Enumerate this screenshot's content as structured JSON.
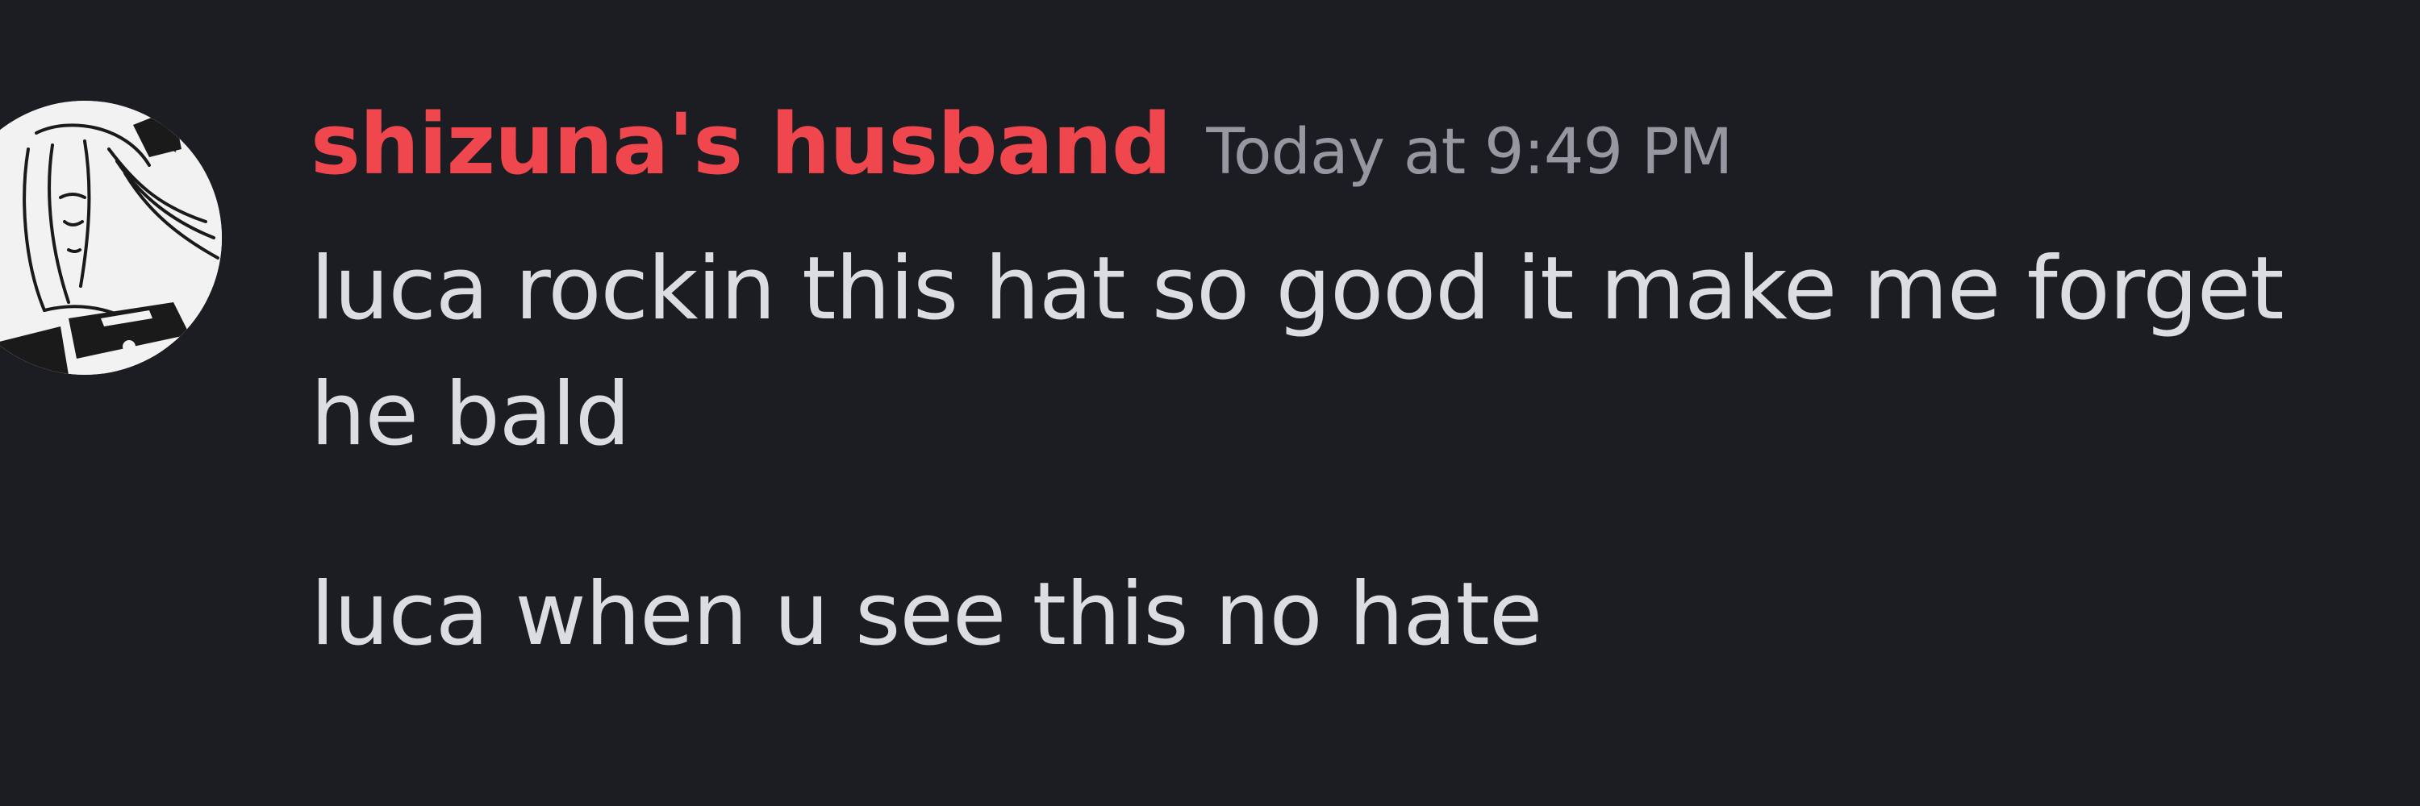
{
  "message": {
    "author": {
      "name": "shizuna's husband",
      "name_color": "#f0474f",
      "avatar": "anime-girl-avatar"
    },
    "timestamp": "Today at 9:49 PM",
    "lines": [
      "luca rockin this hat so good it make me forget",
      "he bald",
      "luca when u see this no hate"
    ]
  },
  "colors": {
    "background": "#1c1d22",
    "text": "#dcdde1",
    "timestamp": "#9598a1"
  }
}
